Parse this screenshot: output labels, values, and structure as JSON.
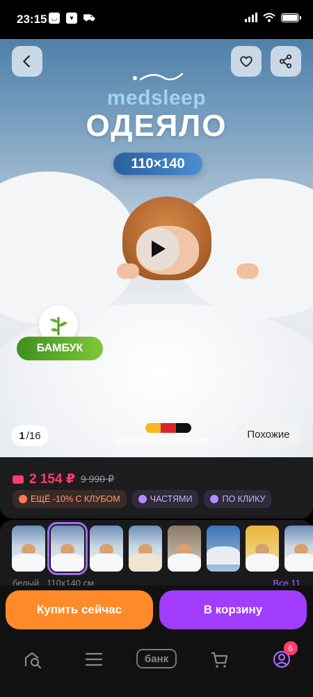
{
  "status_bar": {
    "time": "23:15"
  },
  "hero": {
    "brand": "medsleep",
    "title": "ОДЕЯЛО",
    "size": "110×140",
    "bamboo_label": "БАМБУК",
    "counter_current": "1",
    "counter_total": "/16",
    "designed": "DESIGNED IN GERMANY",
    "similar_label": "Похожие",
    "flag_colors": [
      "#f2b81e",
      "#d8262b",
      "#111111"
    ]
  },
  "price": {
    "current": "2 154 ₽",
    "old": "9 990 ₽",
    "chips": [
      {
        "label": "ЕЩЁ -10% С КЛУБОМ",
        "color": "#ff7a5a"
      },
      {
        "label": "ЧАСТЯМИ",
        "color": "#b58cff"
      },
      {
        "label": "ПО КЛИКУ",
        "color": "#b58cff"
      }
    ]
  },
  "thumbnails": {
    "caption": "белый , 110х140 см",
    "all_label": "Все 11"
  },
  "actions": {
    "buy_now": "Купить сейчас",
    "to_cart": "В корзину"
  },
  "tabbar": {
    "bank_label": "банк",
    "profile_badge": "6"
  },
  "colors": {
    "accent_purple": "#a13dff",
    "accent_orange": "#ff8a2a",
    "price_red": "#ff3d6b"
  }
}
